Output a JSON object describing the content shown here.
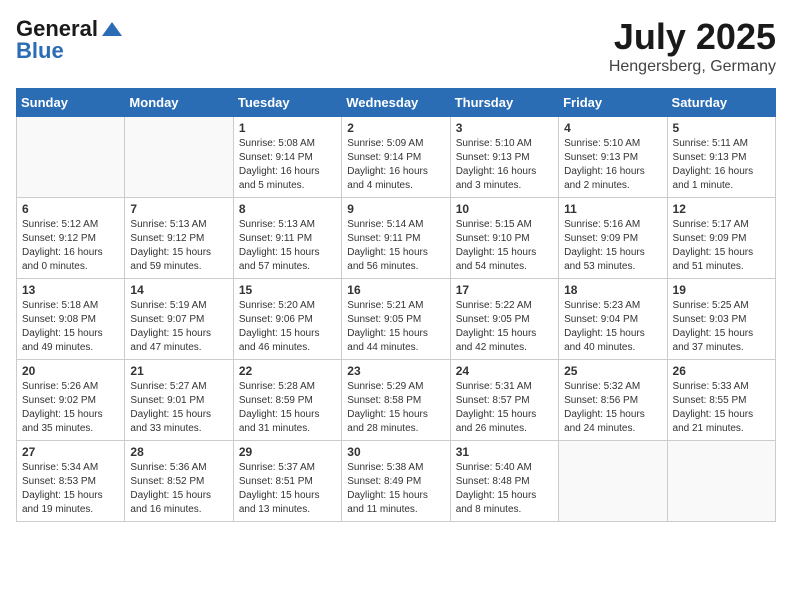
{
  "logo": {
    "general": "General",
    "blue": "Blue"
  },
  "title": {
    "month_year": "July 2025",
    "location": "Hengersberg, Germany"
  },
  "days_of_week": [
    "Sunday",
    "Monday",
    "Tuesday",
    "Wednesday",
    "Thursday",
    "Friday",
    "Saturday"
  ],
  "weeks": [
    [
      {
        "day": "",
        "content": ""
      },
      {
        "day": "",
        "content": ""
      },
      {
        "day": "1",
        "content": "Sunrise: 5:08 AM\nSunset: 9:14 PM\nDaylight: 16 hours\nand 5 minutes."
      },
      {
        "day": "2",
        "content": "Sunrise: 5:09 AM\nSunset: 9:14 PM\nDaylight: 16 hours\nand 4 minutes."
      },
      {
        "day": "3",
        "content": "Sunrise: 5:10 AM\nSunset: 9:13 PM\nDaylight: 16 hours\nand 3 minutes."
      },
      {
        "day": "4",
        "content": "Sunrise: 5:10 AM\nSunset: 9:13 PM\nDaylight: 16 hours\nand 2 minutes."
      },
      {
        "day": "5",
        "content": "Sunrise: 5:11 AM\nSunset: 9:13 PM\nDaylight: 16 hours\nand 1 minute."
      }
    ],
    [
      {
        "day": "6",
        "content": "Sunrise: 5:12 AM\nSunset: 9:12 PM\nDaylight: 16 hours\nand 0 minutes."
      },
      {
        "day": "7",
        "content": "Sunrise: 5:13 AM\nSunset: 9:12 PM\nDaylight: 15 hours\nand 59 minutes."
      },
      {
        "day": "8",
        "content": "Sunrise: 5:13 AM\nSunset: 9:11 PM\nDaylight: 15 hours\nand 57 minutes."
      },
      {
        "day": "9",
        "content": "Sunrise: 5:14 AM\nSunset: 9:11 PM\nDaylight: 15 hours\nand 56 minutes."
      },
      {
        "day": "10",
        "content": "Sunrise: 5:15 AM\nSunset: 9:10 PM\nDaylight: 15 hours\nand 54 minutes."
      },
      {
        "day": "11",
        "content": "Sunrise: 5:16 AM\nSunset: 9:09 PM\nDaylight: 15 hours\nand 53 minutes."
      },
      {
        "day": "12",
        "content": "Sunrise: 5:17 AM\nSunset: 9:09 PM\nDaylight: 15 hours\nand 51 minutes."
      }
    ],
    [
      {
        "day": "13",
        "content": "Sunrise: 5:18 AM\nSunset: 9:08 PM\nDaylight: 15 hours\nand 49 minutes."
      },
      {
        "day": "14",
        "content": "Sunrise: 5:19 AM\nSunset: 9:07 PM\nDaylight: 15 hours\nand 47 minutes."
      },
      {
        "day": "15",
        "content": "Sunrise: 5:20 AM\nSunset: 9:06 PM\nDaylight: 15 hours\nand 46 minutes."
      },
      {
        "day": "16",
        "content": "Sunrise: 5:21 AM\nSunset: 9:05 PM\nDaylight: 15 hours\nand 44 minutes."
      },
      {
        "day": "17",
        "content": "Sunrise: 5:22 AM\nSunset: 9:05 PM\nDaylight: 15 hours\nand 42 minutes."
      },
      {
        "day": "18",
        "content": "Sunrise: 5:23 AM\nSunset: 9:04 PM\nDaylight: 15 hours\nand 40 minutes."
      },
      {
        "day": "19",
        "content": "Sunrise: 5:25 AM\nSunset: 9:03 PM\nDaylight: 15 hours\nand 37 minutes."
      }
    ],
    [
      {
        "day": "20",
        "content": "Sunrise: 5:26 AM\nSunset: 9:02 PM\nDaylight: 15 hours\nand 35 minutes."
      },
      {
        "day": "21",
        "content": "Sunrise: 5:27 AM\nSunset: 9:01 PM\nDaylight: 15 hours\nand 33 minutes."
      },
      {
        "day": "22",
        "content": "Sunrise: 5:28 AM\nSunset: 8:59 PM\nDaylight: 15 hours\nand 31 minutes."
      },
      {
        "day": "23",
        "content": "Sunrise: 5:29 AM\nSunset: 8:58 PM\nDaylight: 15 hours\nand 28 minutes."
      },
      {
        "day": "24",
        "content": "Sunrise: 5:31 AM\nSunset: 8:57 PM\nDaylight: 15 hours\nand 26 minutes."
      },
      {
        "day": "25",
        "content": "Sunrise: 5:32 AM\nSunset: 8:56 PM\nDaylight: 15 hours\nand 24 minutes."
      },
      {
        "day": "26",
        "content": "Sunrise: 5:33 AM\nSunset: 8:55 PM\nDaylight: 15 hours\nand 21 minutes."
      }
    ],
    [
      {
        "day": "27",
        "content": "Sunrise: 5:34 AM\nSunset: 8:53 PM\nDaylight: 15 hours\nand 19 minutes."
      },
      {
        "day": "28",
        "content": "Sunrise: 5:36 AM\nSunset: 8:52 PM\nDaylight: 15 hours\nand 16 minutes."
      },
      {
        "day": "29",
        "content": "Sunrise: 5:37 AM\nSunset: 8:51 PM\nDaylight: 15 hours\nand 13 minutes."
      },
      {
        "day": "30",
        "content": "Sunrise: 5:38 AM\nSunset: 8:49 PM\nDaylight: 15 hours\nand 11 minutes."
      },
      {
        "day": "31",
        "content": "Sunrise: 5:40 AM\nSunset: 8:48 PM\nDaylight: 15 hours\nand 8 minutes."
      },
      {
        "day": "",
        "content": ""
      },
      {
        "day": "",
        "content": ""
      }
    ]
  ]
}
